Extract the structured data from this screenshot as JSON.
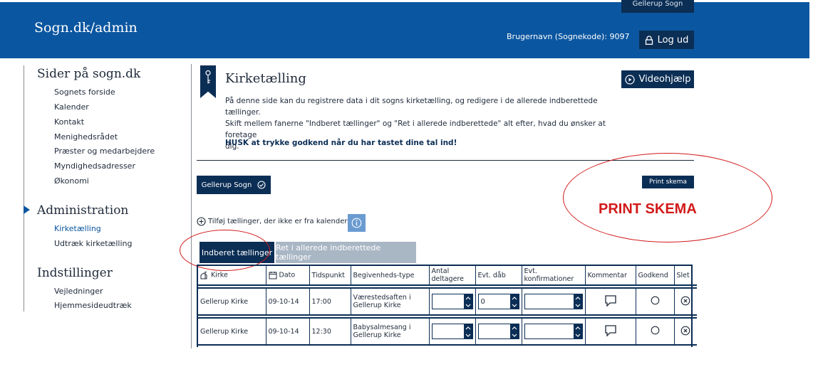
{
  "header": {
    "site_title": "Sogn.dk/admin",
    "parish_tab": "Gellerup Sogn",
    "username": "Brugernavn (Sognekode): 9097",
    "logout_label": "Log ud"
  },
  "sidebar": {
    "sections": [
      {
        "heading": "Sider på sogn.dk",
        "items": [
          "Sognets forside",
          "Kalender",
          "Kontakt",
          "Menighedsrådet",
          "Præster og medarbejdere",
          "Myndighedsadresser",
          "Økonomi"
        ]
      },
      {
        "heading": "Administration",
        "items": [
          "Kirketælling",
          "Udtræk kirketælling"
        ],
        "active_item": "Kirketælling"
      },
      {
        "heading": "Indstillinger",
        "items": [
          "Vejledninger",
          "Hjemmesideudtræk"
        ]
      }
    ]
  },
  "main": {
    "title": "Kirketælling",
    "video_help_label": "Videohjælp",
    "intro_lines": [
      "På denne side kan du registrere data i dit sogns kirketælling, og redigere i de allerede indberettede tællinger.",
      "Skift mellem fanerne \"Indberet tællinger\" og \"Ret i allerede indberettede\" alt efter, hvad du ønsker at foretage",
      "dig."
    ],
    "remember_text": "HUSK at trykke godkend når du har tastet dine tal ind!",
    "parish_button": "Gellerup Sogn",
    "print_button": "Print skema",
    "print_callout": "PRINT SKEMA",
    "add_link": "Tilføj tællinger, der ikke er fra kalenderen",
    "tabs": [
      {
        "label": "Indberet tællinger",
        "active": true
      },
      {
        "label": "Ret i allerede indberettede tællinger",
        "active": false
      }
    ]
  },
  "table": {
    "columns": [
      "Kirke",
      "Dato",
      "Tidspunkt",
      "Begivenheds-type",
      "Antal deltagere",
      "Evt. dåb",
      "Evt. konfirmationer",
      "Kommentar",
      "Godkend",
      "Slet"
    ],
    "rows": [
      {
        "kirke": "Gellerup Kirke",
        "dato": "09-10-14",
        "tidspunkt": "17:00",
        "type": "Værestedsaften i Gellerup Kirke",
        "deltagere": "",
        "daab": "0",
        "konfirmationer": ""
      },
      {
        "kirke": "Gellerup Kirke",
        "dato": "09-10-14",
        "tidspunkt": "12:30",
        "type": "Babysalmesang i Gellerup Kirke",
        "deltagere": "",
        "daab": "",
        "konfirmationer": ""
      }
    ]
  },
  "colors": {
    "header_blue": "#0b56a0",
    "dark_navy": "#0b2e55",
    "annotation_red": "#d21a1a",
    "inactive_tab": "#a9b6c4",
    "info_blue": "#6a9bd0"
  }
}
